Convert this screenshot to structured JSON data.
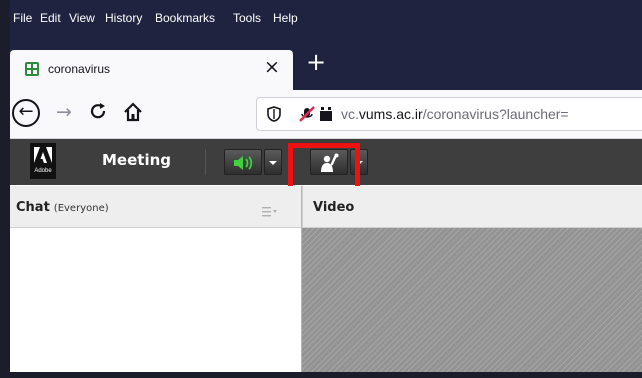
{
  "menubar": {
    "items": [
      {
        "label": "File"
      },
      {
        "label": "Edit"
      },
      {
        "label": "View"
      },
      {
        "label": "History"
      },
      {
        "label": "Bookmarks"
      },
      {
        "label": "Tools"
      },
      {
        "label": "Help"
      }
    ]
  },
  "tab": {
    "title": "coronavirus",
    "close_label": "×",
    "new_tab_label": "+"
  },
  "nav": {
    "back_label": "←",
    "forward_label": "→",
    "url_domain": "vc.vums.ac.ir",
    "url_prefix": "vc.",
    "url_host": "vums.ac.ir",
    "url_path": "/coronavirus?launcher="
  },
  "app": {
    "logo_text": "Adobe",
    "meeting_label": "Meeting"
  },
  "chat_pod": {
    "title": "Chat",
    "subtitle": "(Everyone)"
  },
  "video_pod": {
    "title": "Video"
  },
  "colors": {
    "browser_chrome": "#202340",
    "app_bar": "#3e3e3e",
    "highlight": "#ee1111",
    "speaker_green": "#3fd13f"
  }
}
